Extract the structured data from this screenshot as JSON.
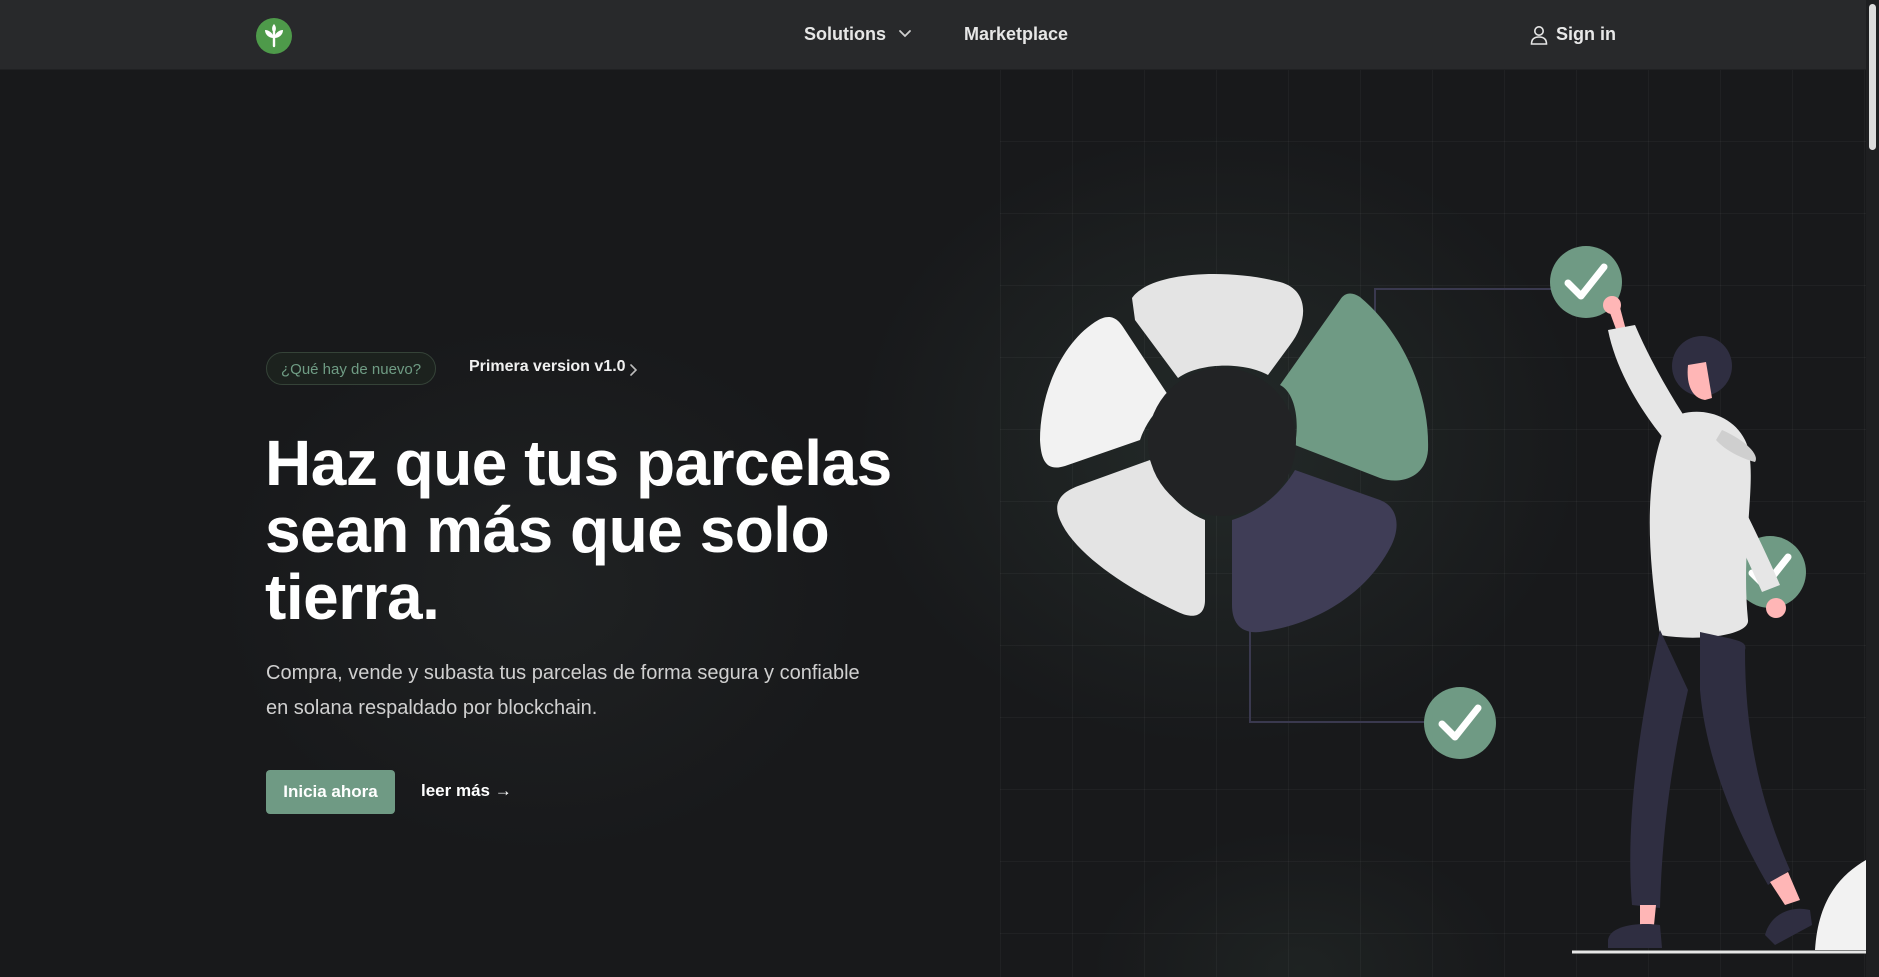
{
  "nav": {
    "solutions": "Solutions",
    "marketplace": "Marketplace",
    "sign_in": "Sign in"
  },
  "hero": {
    "badge": "¿Qué hay de nuevo?",
    "release": "Primera version v1.0",
    "title": "Haz que tus parcelas sean más que solo tierra.",
    "subtitle": "Compra, vende y subasta tus parcelas de forma segura y confiable en solana respaldado por blockchain.",
    "cta": "Inicia ahora",
    "more": "leer más →"
  },
  "colors": {
    "accent": "#6f9a84",
    "background": "#18191b",
    "header": "#28292b",
    "purple": "#3f3d56"
  }
}
